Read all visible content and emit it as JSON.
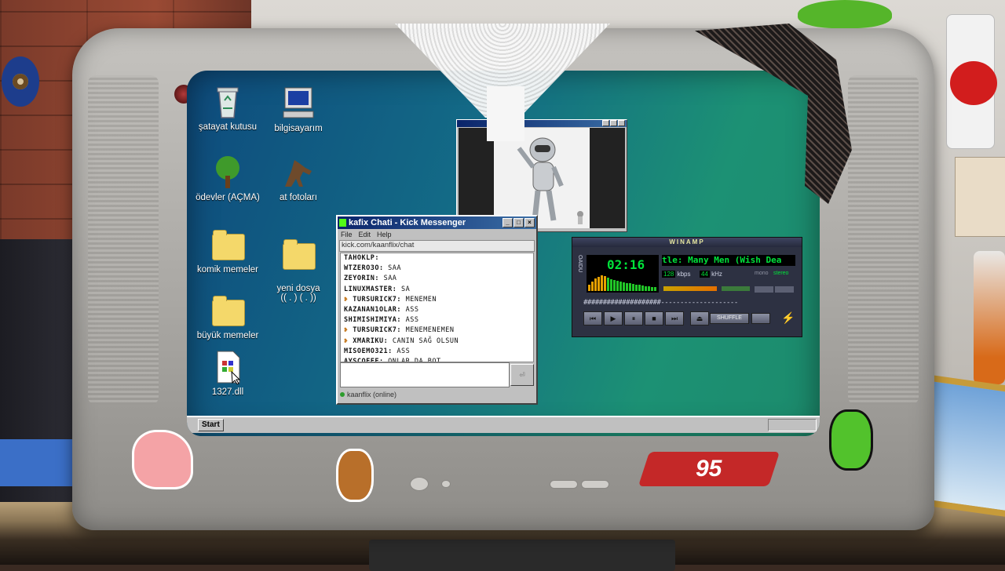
{
  "desktop": {
    "icons": [
      {
        "label": "şatayat kutusu",
        "icon": "recycle-bin-icon"
      },
      {
        "label": "bilgisayarım",
        "icon": "computer-icon"
      },
      {
        "label": "ödevler (AÇMA)",
        "icon": "tree-icon"
      },
      {
        "label": "at fotoları",
        "icon": "horse-icon"
      },
      {
        "label": "komik memeler",
        "icon": "folder-icon"
      },
      {
        "label": "yeni dosya\n(( . ) ( . ))",
        "icon": "folder-icon"
      },
      {
        "label": "büyük memeler",
        "icon": "folder-icon"
      },
      {
        "label": "1327.dll",
        "icon": "dll-file-icon"
      }
    ]
  },
  "chat_window": {
    "title": "kafix Chati - Kick Messenger",
    "menu": [
      "File",
      "Edit",
      "Help"
    ],
    "url": "kick.com/kaanflix/chat",
    "messages": [
      {
        "user": "TAHOKLP:",
        "text": ""
      },
      {
        "user": "WTZERO3O:",
        "text": "SAA"
      },
      {
        "user": "ZEYORIN:",
        "text": "SAA"
      },
      {
        "user": "LINUXMASTER:",
        "text": "SA"
      },
      {
        "user": "TURSURICK7:",
        "text": "MENEMEN",
        "badge": true
      },
      {
        "user": "KAZANAN1OLAR:",
        "text": "ASS"
      },
      {
        "user": "SHIMISHIMIYA:",
        "text": "ASS"
      },
      {
        "user": "TURSURICK7:",
        "text": "MENEMENEMEN",
        "badge": true
      },
      {
        "user": "XMARIKU:",
        "text": "CANIN SAĞ OLSUN",
        "badge": true
      },
      {
        "user": "MISOEMO321:",
        "text": "ASS"
      },
      {
        "user": "AYSCOFFE:",
        "text": "ONLAR DA BOT"
      }
    ],
    "send_label": "",
    "status": "kaanflix (online)"
  },
  "winamp": {
    "title": "WINAMP",
    "time": "02:16",
    "track": "tle: Many Men (Wish Dea",
    "kbps": "128",
    "kbps_label": "kbps",
    "khz": "44",
    "khz_label": "kHz",
    "mono": "mono",
    "stereo": "stereo",
    "seek": "####################--------------------",
    "shuffle_label": "SHUFFLE",
    "side_label": "OAIDU",
    "controls": [
      "⏮",
      "▶",
      "⏸",
      "■",
      "⏭",
      "⏏"
    ]
  },
  "taskbar": {
    "start_label": "Start"
  },
  "stickers": {
    "ninety_five": "95"
  }
}
